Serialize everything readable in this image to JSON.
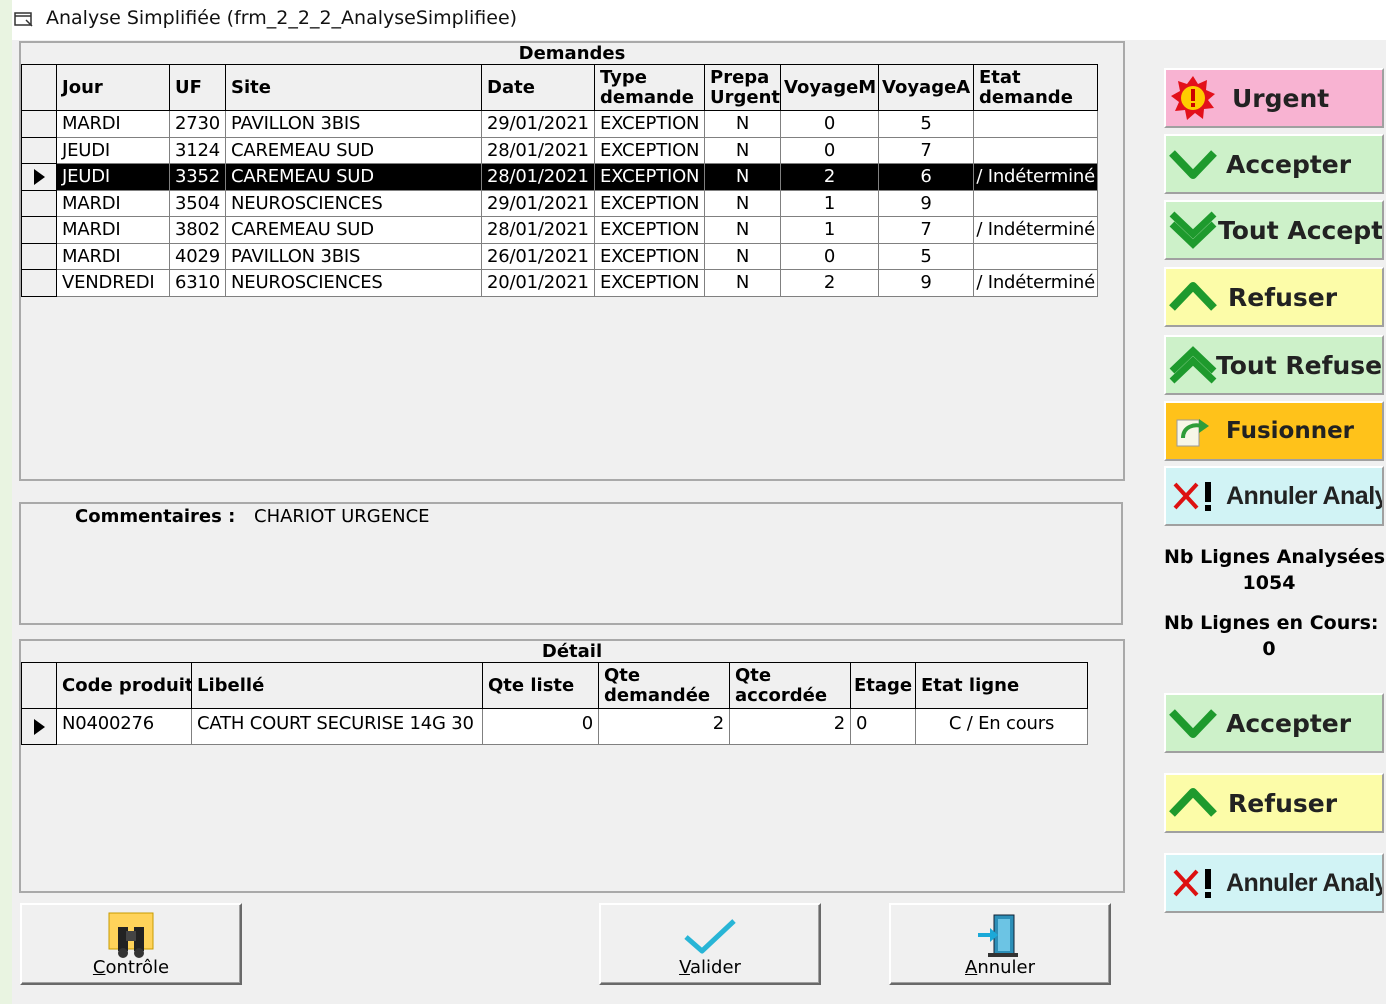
{
  "window": {
    "title": "Analyse Simplifiée (frm_2_2_2_AnalyseSimplifiee)"
  },
  "demandes": {
    "caption": "Demandes",
    "columns": [
      "Jour",
      "UF",
      "Site",
      "Date",
      "Type demande",
      "Prepa Urgente",
      "VoyageM",
      "VoyageA",
      "Etat demande"
    ],
    "rows": [
      [
        "MARDI",
        "2730",
        "PAVILLON 3BIS",
        "29/01/2021",
        "EXCEPTION",
        "N",
        "0",
        "5",
        ""
      ],
      [
        "JEUDI",
        "3124",
        "CAREMEAU SUD",
        "28/01/2021",
        "EXCEPTION",
        "N",
        "0",
        "7",
        ""
      ],
      [
        "JEUDI",
        "3352",
        "CAREMEAU SUD",
        "28/01/2021",
        "EXCEPTION",
        "N",
        "2",
        "6",
        "I / Indéterminé"
      ],
      [
        "MARDI",
        "3504",
        "NEUROSCIENCES",
        "29/01/2021",
        "EXCEPTION",
        "N",
        "1",
        "9",
        ""
      ],
      [
        "MARDI",
        "3802",
        "CAREMEAU SUD",
        "28/01/2021",
        "EXCEPTION",
        "N",
        "1",
        "7",
        "I / Indéterminé"
      ],
      [
        "MARDI",
        "4029",
        "PAVILLON 3BIS",
        "26/01/2021",
        "EXCEPTION",
        "N",
        "0",
        "5",
        ""
      ],
      [
        "VENDREDI",
        "6310",
        "NEUROSCIENCES",
        "20/01/2021",
        "EXCEPTION",
        "N",
        "2",
        "9",
        "I / Indéterminé"
      ]
    ],
    "selected_row": 2
  },
  "commentaires": {
    "label": "Commentaires :",
    "value": "CHARIOT URGENCE"
  },
  "detail": {
    "caption": "Détail",
    "columns": [
      "Code produit",
      "Libellé",
      "Qte liste",
      "Qte demandée",
      "Qte accordée",
      "Etage",
      "Etat ligne"
    ],
    "rows": [
      [
        "N0400276",
        "CATH COURT SECURISE 14G 30",
        "0",
        "2",
        "2",
        "0",
        "C / En cours"
      ]
    ]
  },
  "side": {
    "urgent": "Urgent",
    "accepter": "Accepter",
    "tout_accepter": "Tout Accepter",
    "refuser": "Refuser",
    "tout_refuser": "Tout Refuser",
    "fusionner": "Fusionner",
    "annuler_analyse": "Annuler Analyse",
    "nb_analysees_label": "Nb Lignes Analysées:",
    "nb_analysees_value": "1054",
    "nb_encours_label": "Nb Lignes en Cours:",
    "nb_encours_value": "0",
    "accepter2": "Accepter",
    "refuser2": "Refuser",
    "annuler_analyse2": "Annuler Analyse"
  },
  "bottom": {
    "controle_first": "C",
    "controle_rest": "ontrôle",
    "valider_first": "V",
    "valider_rest": "alider",
    "annuler_first": "A",
    "annuler_rest": "nnuler"
  },
  "colors": {
    "urgent_bg": "#f8b3d2",
    "accept_bg": "#cdf1c9",
    "refuse_bg": "#fcfca8",
    "fusion_bg": "#ffc21a",
    "cancel_bg": "#d1f3f5",
    "selected_row": "#000000"
  },
  "icons": [
    "window-form-icon",
    "urgent-icon",
    "check-chevron-icon",
    "double-check-chevron-icon",
    "up-chevron-icon",
    "double-up-chevron-icon",
    "merge-icon",
    "cross-exclamation-icon",
    "binoculars-icon",
    "checkmark-icon",
    "exit-door-icon",
    "row-pointer-icon"
  ]
}
